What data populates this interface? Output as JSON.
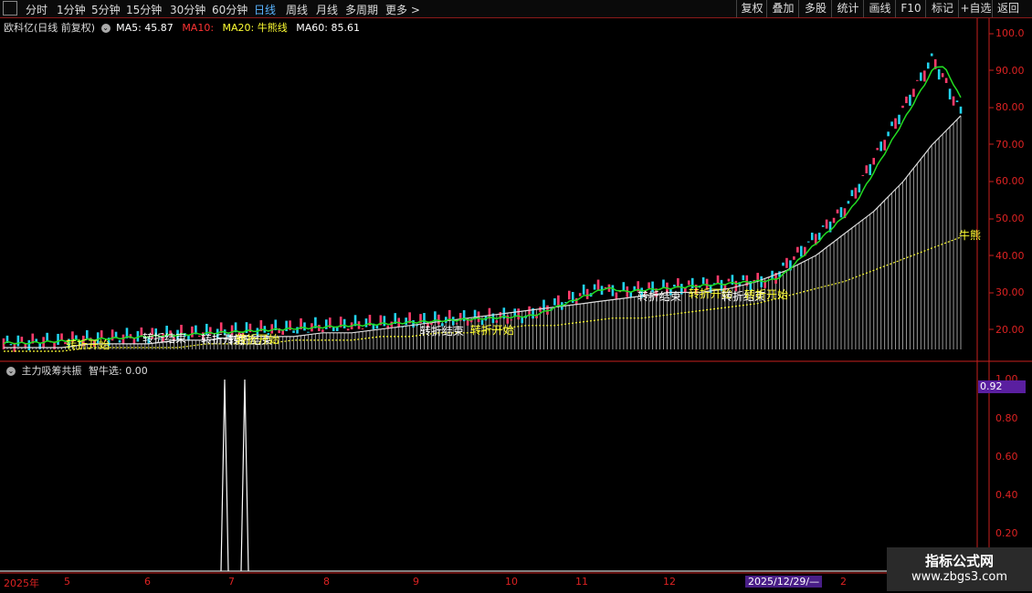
{
  "toolbar": {
    "periods": [
      "分时",
      "1分钟",
      "5分钟",
      "15分钟",
      "30分钟",
      "60分钟",
      "日线",
      "周线",
      "月线",
      "多周期",
      "更多 >"
    ],
    "active_period": "日线",
    "right_buttons": [
      "复权",
      "叠加",
      "多股",
      "统计",
      "画线",
      "F10",
      "标记",
      "+自选",
      "返回"
    ]
  },
  "main_legend": {
    "title": "欧科亿(日线 前复权)",
    "ma5": "MA5: 45.87",
    "ma10": "MA10:",
    "ma20": "MA20: 牛熊线",
    "ma60": "MA60: 85.61"
  },
  "sub_legend": {
    "title": "主力吸筹共振",
    "value": "智牛选: 0.00"
  },
  "price_axis": [
    "100.0",
    "90.00",
    "80.00",
    "70.00",
    "60.00",
    "50.00",
    "40.00",
    "30.00",
    "20.00"
  ],
  "sub_axis": [
    "1.00",
    "0.80",
    "0.60",
    "0.40",
    "0.20"
  ],
  "sub_axis_marker": "0.92",
  "right_edge_label": "牛熊",
  "x_axis": [
    "2025年",
    "5",
    "6",
    "7",
    "8",
    "9",
    "10",
    "11",
    "12",
    "2025/12/29/—",
    "2"
  ],
  "annotations": [
    "转折开始",
    "转折结束",
    "转折开始",
    "转折结束",
    "转折开始",
    "转折结束",
    "转折开始",
    "转折结束",
    "转折开始",
    "转折结束",
    "转折开始"
  ],
  "watermark": {
    "line1": "指标公式网",
    "line2": "www.zbgs3.com"
  },
  "colors": {
    "up": "#ff3b6b",
    "down": "#22d3ee",
    "ma5": "#ffffff",
    "ma20": "#ffff33",
    "ma60": "#22dd22",
    "axis": "#c8201e"
  },
  "chart_data": {
    "type": "line",
    "series": [
      {
        "name": "MA60",
        "values": [
          15,
          15,
          15,
          16,
          16,
          16,
          17,
          17,
          18,
          18,
          18,
          19,
          19,
          20,
          21,
          22,
          23,
          24,
          25,
          26,
          27,
          28,
          29,
          30,
          30,
          31,
          33,
          36,
          40,
          46,
          52,
          60,
          70,
          78
        ]
      },
      {
        "name": "MA20",
        "values": [
          14,
          14,
          14,
          15,
          15,
          15,
          15,
          16,
          16,
          16,
          17,
          17,
          17,
          18,
          18,
          19,
          19,
          20,
          21,
          21,
          22,
          23,
          23,
          24,
          25,
          26,
          27,
          29,
          31,
          33,
          36,
          39,
          42,
          45
        ]
      }
    ],
    "ylim": [
      14,
      102
    ]
  }
}
